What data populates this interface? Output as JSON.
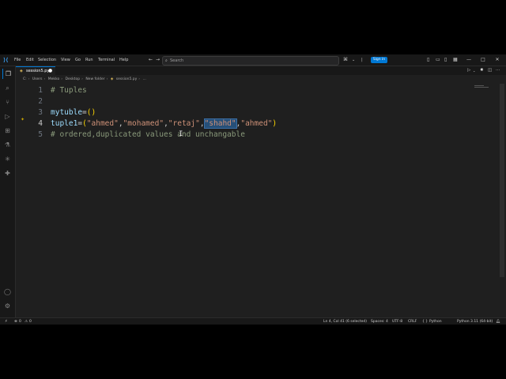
{
  "menu": [
    "File",
    "Edit",
    "Selection",
    "View",
    "Go",
    "Run",
    "Terminal",
    "Help"
  ],
  "search": {
    "placeholder": "Search"
  },
  "signin_label": "Sign in",
  "tab": {
    "filename": "session5.py"
  },
  "breadcrumb": [
    "C:",
    "Users",
    "Mekko",
    "Desktop",
    "New folder",
    "session5.py",
    "..."
  ],
  "editor": {
    "lines": [
      {
        "num": "1",
        "text": "# Tuples"
      },
      {
        "num": "2",
        "text": ""
      },
      {
        "num": "3",
        "var": "mytuble",
        "op": "=",
        "paren": "()"
      },
      {
        "num": "4",
        "var": "tuple1",
        "op": "=",
        "open": "(",
        "strings": [
          "\"ahmed\"",
          "\"mohamed\"",
          "\"retaj\"",
          "\"shahd\"",
          "\"ahmed\""
        ],
        "sep": ",",
        "close": ")"
      },
      {
        "num": "5",
        "text": "# ordered,duplicated values and unchangable"
      }
    ],
    "current_line": 4,
    "selected_string_index": 3
  },
  "status": {
    "problems_errors": "0",
    "problems_warnings": "0",
    "position": "Ln 4, Col 41 (6 selected)",
    "spaces": "Spaces: 4",
    "encoding": "UTF-8",
    "eol": "CRLF",
    "braces": "{ }",
    "language": "Python",
    "interpreter": "Python 3.11 (64-bit)"
  },
  "colors": {
    "accent": "#0078d4",
    "editor_bg": "#1f1f1f",
    "comment": "#8a9a7b",
    "string": "#ce9178",
    "variable": "#9cdcfe",
    "bracket": "#ffd700",
    "selection": "#264f78"
  }
}
